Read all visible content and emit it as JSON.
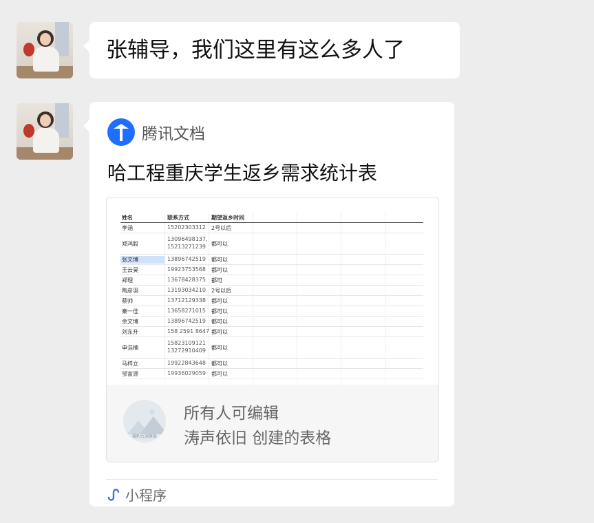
{
  "messages": [
    {
      "text": "张辅导，我们这里有这么多人了"
    }
  ],
  "card": {
    "source": "腾讯文档",
    "title": "哈工程重庆学生返乡需求统计表",
    "permission": "所有人可编辑",
    "creator": "涛声依旧 创建的表格",
    "thumb_caption": "福利九洲原县",
    "footer_label": "小程序",
    "sheet": {
      "headers": [
        "姓名",
        "联系方式",
        "期望返乡时间"
      ],
      "rows": [
        [
          "李涵",
          "15202303312",
          "2号以后"
        ],
        [
          "郑鸿毅",
          "13096498137, 15213271239",
          "都可以"
        ],
        [
          "张文博",
          "13896742519",
          "都可以"
        ],
        [
          "王云昊",
          "19923753568",
          "都可以"
        ],
        [
          "郑理",
          "13678428375",
          "都可"
        ],
        [
          "陶彦羽",
          "13193034210",
          "2号以后"
        ],
        [
          "蔡帅",
          "13712129338",
          "都可以"
        ],
        [
          "秦一佳",
          "13658271015",
          "都可以"
        ],
        [
          "余文博",
          "13896742519",
          "都可以"
        ],
        [
          "刘东升",
          "158 2591 8647",
          "都可以"
        ],
        [
          "申浩楠",
          "15823109121 13272910409",
          "都可以"
        ],
        [
          "马梓立",
          "19922843648",
          "都可以"
        ],
        [
          "邹富源",
          "19936029059",
          "都可以"
        ]
      ]
    }
  },
  "colors": {
    "background": "#ededed",
    "bubble": "#ffffff",
    "tencent_docs_blue": "#1e6fff",
    "mini_program_blue": "#4a6fd6",
    "selected_cell": "#cfe2fb"
  }
}
